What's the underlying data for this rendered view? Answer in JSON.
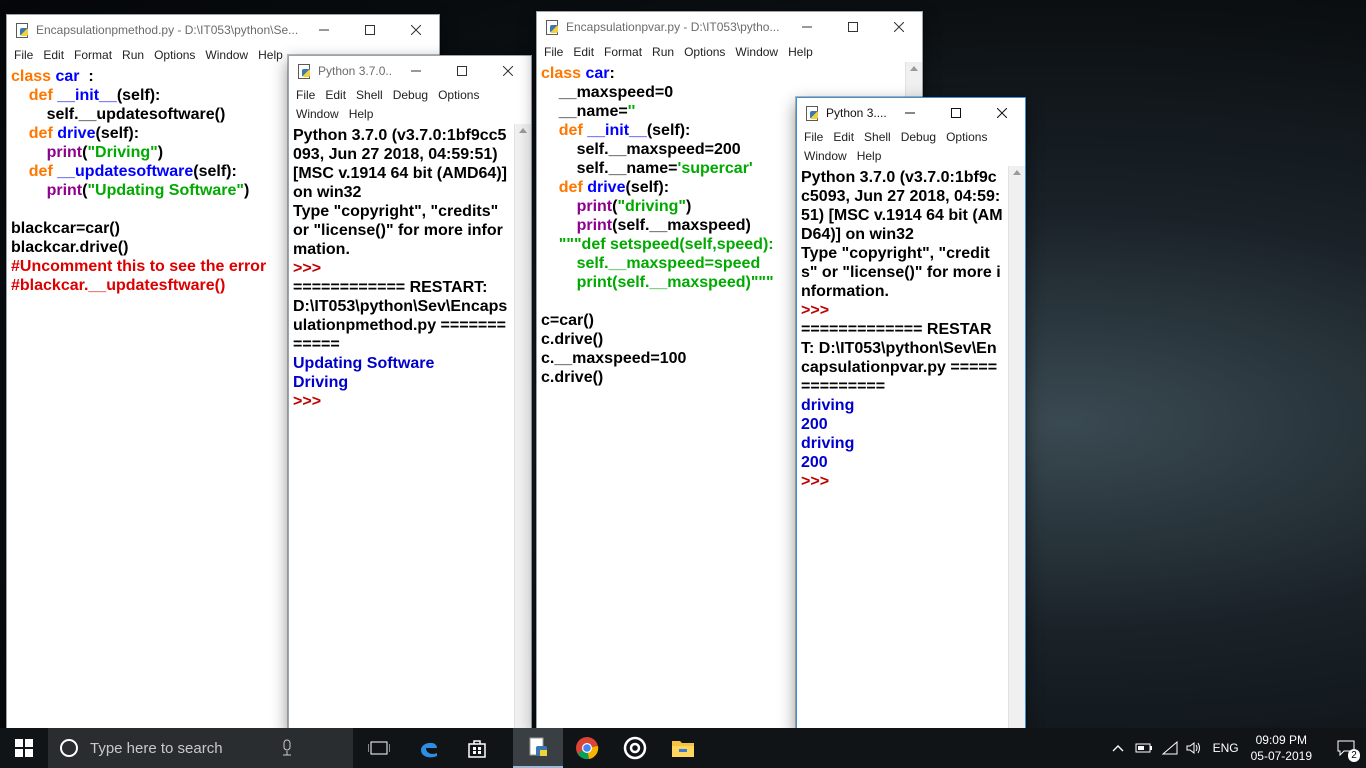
{
  "editor1": {
    "title": "Encapsulationpmethod.py - D:\\IT053\\python\\Se...",
    "menu": [
      "File",
      "Edit",
      "Format",
      "Run",
      "Options",
      "Window",
      "Help"
    ],
    "code": [
      [
        [
          "kw",
          "class "
        ],
        [
          "fn",
          "car"
        ],
        [
          "",
          "  :"
        ]
      ],
      [
        [
          "",
          "    "
        ],
        [
          "kw",
          "def "
        ],
        [
          "fn",
          "__init__"
        ],
        [
          "",
          "(self):"
        ]
      ],
      [
        [
          "",
          "        self.__updatesoftware()"
        ]
      ],
      [
        [
          "",
          "    "
        ],
        [
          "kw",
          "def "
        ],
        [
          "fn",
          "drive"
        ],
        [
          "",
          "(self):"
        ]
      ],
      [
        [
          "",
          "        "
        ],
        [
          "bi",
          "print"
        ],
        [
          "",
          "("
        ],
        [
          "st",
          "\"Driving\""
        ],
        [
          "",
          ")"
        ]
      ],
      [
        [
          "",
          "    "
        ],
        [
          "kw",
          "def "
        ],
        [
          "fn",
          "__updatesoftware"
        ],
        [
          "",
          "(self):"
        ]
      ],
      [
        [
          "",
          "        "
        ],
        [
          "bi",
          "print"
        ],
        [
          "",
          "("
        ],
        [
          "st",
          "\"Updating Software\""
        ],
        [
          "",
          ")"
        ]
      ],
      [
        [
          "",
          ""
        ]
      ],
      [
        [
          "",
          "blackcar=car()"
        ]
      ],
      [
        [
          "",
          "blackcar.drive()"
        ]
      ],
      [
        [
          "cm",
          "#Uncomment this to see the error"
        ]
      ],
      [
        [
          "cm",
          "#blackcar.__updatesftware()"
        ]
      ]
    ]
  },
  "shell1": {
    "title": "Python 3.7.0...",
    "menu_row1": [
      "File",
      "Edit",
      "Shell",
      "Debug",
      "Options"
    ],
    "menu_row2": [
      "Window",
      "Help"
    ],
    "output": [
      [
        "",
        "Python 3.7.0 (v3.7.0:1bf9cc5093, Jun 27 2018, 04:59:51) [MSC v.1914 64 bit (AMD64)] on win32"
      ],
      [
        "",
        "Type \"copyright\", \"credits\" or \"license()\" for more information."
      ],
      [
        "pr",
        ">>> "
      ],
      [
        "",
        "============ RESTART: D:\\IT053\\python\\Sev\\Encapsulationpmethod.py ============"
      ],
      [
        "out",
        "Updating Software"
      ],
      [
        "out",
        "Driving"
      ],
      [
        "pr",
        ">>> "
      ]
    ]
  },
  "editor2": {
    "title": "Encapsulationpvar.py - D:\\IT053\\pytho...",
    "menu": [
      "File",
      "Edit",
      "Format",
      "Run",
      "Options",
      "Window",
      "Help"
    ],
    "code": [
      [
        [
          "kw",
          "class "
        ],
        [
          "fn",
          "car"
        ],
        [
          "",
          ":"
        ]
      ],
      [
        [
          "",
          "    __maxspeed=0"
        ]
      ],
      [
        [
          "",
          "    __name="
        ],
        [
          "st",
          "''"
        ]
      ],
      [
        [
          "",
          "    "
        ],
        [
          "kw",
          "def "
        ],
        [
          "fn",
          "__init__"
        ],
        [
          "",
          "(self):"
        ]
      ],
      [
        [
          "",
          "        self.__maxspeed=200"
        ]
      ],
      [
        [
          "",
          "        self.__name="
        ],
        [
          "st",
          "'supercar'"
        ]
      ],
      [
        [
          "",
          "    "
        ],
        [
          "kw",
          "def "
        ],
        [
          "fn",
          "drive"
        ],
        [
          "",
          "(self):"
        ]
      ],
      [
        [
          "",
          "        "
        ],
        [
          "bi",
          "print"
        ],
        [
          "",
          "("
        ],
        [
          "st",
          "\"driving\""
        ],
        [
          "",
          ")"
        ]
      ],
      [
        [
          "",
          "        "
        ],
        [
          "bi",
          "print"
        ],
        [
          "",
          "(self.__maxspeed)"
        ]
      ],
      [
        [
          "st",
          "    \"\"\"def setspeed(self,speed):"
        ]
      ],
      [
        [
          "st",
          "        self.__maxspeed=speed"
        ]
      ],
      [
        [
          "st",
          "        print(self.__maxspeed)\"\"\""
        ]
      ],
      [
        [
          "",
          ""
        ]
      ],
      [
        [
          "",
          "c=car()"
        ]
      ],
      [
        [
          "",
          "c.drive()"
        ]
      ],
      [
        [
          "",
          "c.__maxspeed=100"
        ]
      ],
      [
        [
          "",
          "c.drive()"
        ]
      ]
    ]
  },
  "shell2": {
    "title": "Python 3....",
    "menu_row1": [
      "File",
      "Edit",
      "Shell",
      "Debug",
      "Options"
    ],
    "menu_row2": [
      "Window",
      "Help"
    ],
    "output": [
      [
        "",
        "Python 3.7.0 (v3.7.0:1bf9cc5093, Jun 27 2018, 04:59:51) [MSC v.1914 64 bit (AMD64)] on win32"
      ],
      [
        "",
        "Type \"copyright\", \"credits\" or \"license()\" for more information."
      ],
      [
        "pr",
        ">>> "
      ],
      [
        "",
        "============= RESTART: D:\\IT053\\python\\Sev\\Encapsulationpvar.py =============="
      ],
      [
        "out",
        "driving"
      ],
      [
        "out",
        "200"
      ],
      [
        "out",
        "driving"
      ],
      [
        "out",
        "200"
      ],
      [
        "pr",
        ">>> "
      ]
    ]
  },
  "taskbar": {
    "search_placeholder": "Type here to search",
    "language": "ENG",
    "time": "09:09 PM",
    "date": "05-07-2019",
    "notification_count": "2",
    "accent": "#3c8fdd",
    "pinned_icons": [
      "python-idle-icon",
      "chrome-icon",
      "settings-icon",
      "file-explorer-icon"
    ]
  }
}
